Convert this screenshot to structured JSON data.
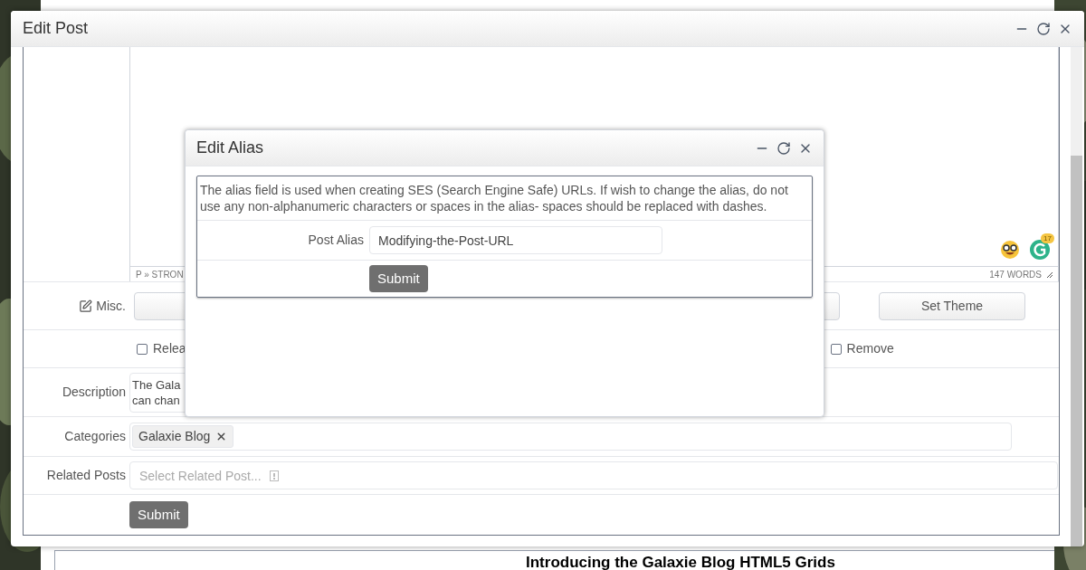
{
  "background_page": {
    "heading": "Introducing the Galaxie Blog HTML5 Grids"
  },
  "edit_post": {
    "title": "Edit Post",
    "editor": {
      "status_path": "P » STRON",
      "word_count": "147 WORDS",
      "grammar_badge": "17"
    },
    "misc": {
      "label": "Misc.",
      "theme_button": "Set Theme"
    },
    "checkboxes": [
      {
        "label": "Relea",
        "checked": false
      },
      {
        "label": "Remove",
        "checked": false
      }
    ],
    "description": {
      "label": "Description",
      "lines": [
        "The Gala",
        "can chan"
      ]
    },
    "categories": {
      "label": "Categories",
      "tags": [
        "Galaxie Blog"
      ]
    },
    "related_posts": {
      "label": "Related Posts",
      "placeholder": "Select Related Post..."
    },
    "submit": "Submit"
  },
  "edit_alias": {
    "title": "Edit Alias",
    "help": "The alias field is used when creating SES (Search Engine Safe) URLs. If wish to change the alias, do not use any non-alphanumeric characters or spaces in the alias- spaces should be replaced with dashes.",
    "field": {
      "label": "Post Alias",
      "value": "Modifying-the-Post-URL"
    },
    "submit": "Submit"
  }
}
